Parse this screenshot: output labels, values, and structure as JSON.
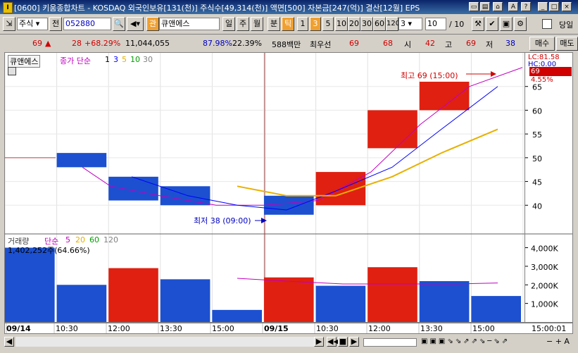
{
  "window": {
    "title": "[0600] 키움종합차트 - KOSDAQ 외국인보유[131(천)] 주식수[49,314(천)] 액면[500] 자본금[247(억)] 결산[12월] EPS",
    "icon_label": "I",
    "buttons": [
      "minimize-icon",
      "restore-icon",
      "close-icon"
    ]
  },
  "toolbar": {
    "market_select": "주식",
    "prev_label": "전",
    "code_value": "052880",
    "search_icon": "search-icon",
    "sound_icon": "speaker-icon",
    "relation_label": "관",
    "stock_name": "큐앤에스",
    "period_buttons": [
      "일",
      "주",
      "월",
      "분",
      "틱"
    ],
    "active_period": "틱",
    "interval_buttons": [
      "1",
      "3",
      "5",
      "10",
      "20",
      "30",
      "60",
      "120"
    ],
    "active_interval": "3",
    "interval_combo": "3",
    "count_value": "10",
    "count_total": "/ 10",
    "buy_label": "매수",
    "sell_label": "매도",
    "today_label": "당일"
  },
  "quote": {
    "price": "69",
    "change_arrow": "▲",
    "change": "28",
    "change_pct": "+68.29%",
    "volume": "11,044,055",
    "vol_pct": "87.98%",
    "turnover": "22.39%",
    "amount": "588백만",
    "pref_label": "최우선",
    "ask": "69",
    "bid": "68",
    "open_label": "시",
    "open": "42",
    "high_label": "고",
    "high": "69",
    "low_label": "저",
    "low": "38"
  },
  "price_panel": {
    "legend_name": "큐앤에스",
    "ma_label": "종가 단순",
    "ma_periods": [
      "1",
      "3",
      "5",
      "10",
      "30"
    ],
    "ma_colors": [
      "#000000",
      "#c000c0",
      "#0000ff",
      "#e8b000",
      "#00a000"
    ],
    "high_annotation": "최고 69 (15:00)",
    "low_annotation": "최저 38 (09:00)",
    "lc_label": "LC:81.58",
    "hc_label": "HC:0.00",
    "current_price": "69",
    "current_pct": "4.55%"
  },
  "volume_panel": {
    "legend_name": "거래량",
    "ma_label": "단순",
    "ma_periods": [
      "5",
      "20",
      "60",
      "120"
    ],
    "max_label": "1,402,252주(64.66%)"
  },
  "chart_data": {
    "type": "candlestick",
    "time_labels": [
      "09/14",
      "10:30",
      "12:00",
      "13:30",
      "15:00",
      "09/15",
      "10:30",
      "12:00",
      "13:30",
      "15:00",
      "15:00:01"
    ],
    "candles": [
      {
        "open": 48,
        "close": 51,
        "color": "blue"
      },
      {
        "open": 46,
        "close": 41,
        "color": "blue"
      },
      {
        "open": 44,
        "close": 40,
        "color": "blue"
      },
      {
        "open": 42,
        "close": 38,
        "color": "blue"
      },
      {
        "open": 40,
        "close": 47,
        "color": "red"
      },
      {
        "open": 52,
        "close": 60,
        "color": "red"
      },
      {
        "open": 60,
        "close": 66,
        "color": "red"
      }
    ],
    "price_ticks": [
      40,
      45,
      50,
      55,
      60,
      65
    ],
    "volume_ticks": [
      "1,000K",
      "2,000K",
      "3,000K",
      "4,000K"
    ],
    "volumes": [
      4000,
      2000,
      2900,
      2300,
      650,
      2400,
      1950,
      2950,
      2200,
      1400
    ],
    "volume_colors": [
      "blue",
      "blue",
      "red",
      "blue",
      "blue",
      "red",
      "blue",
      "red",
      "blue",
      "blue"
    ]
  }
}
